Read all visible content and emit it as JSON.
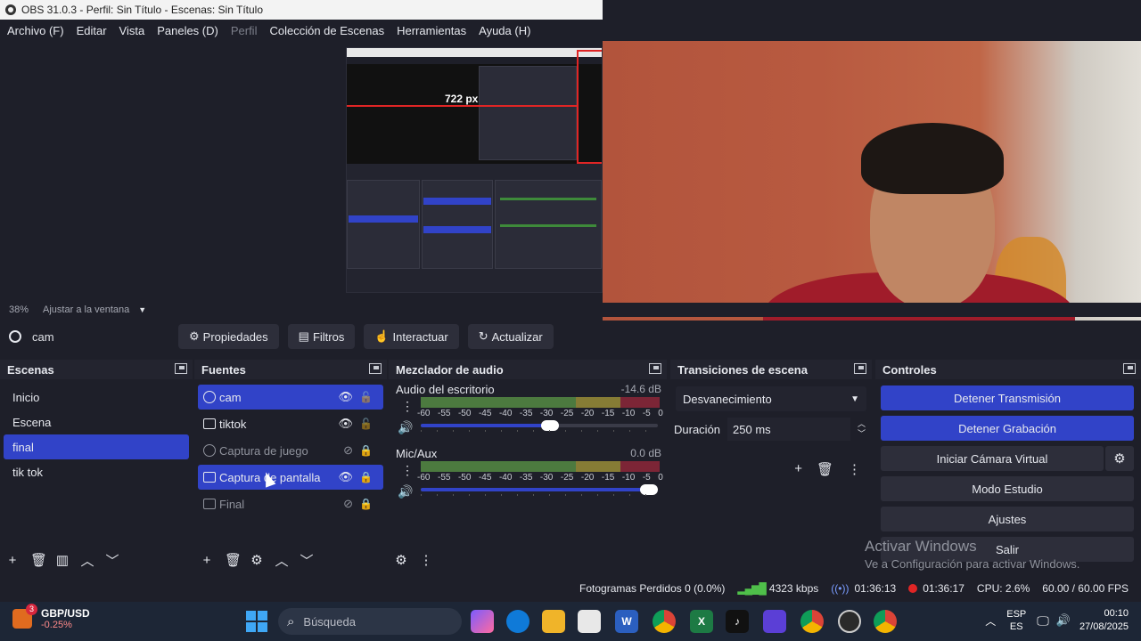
{
  "window": {
    "title": "OBS 31.0.3 - Perfil: Sin Título - Escenas: Sin Título"
  },
  "menu": [
    {
      "label": "Archivo (F)",
      "disabled": false
    },
    {
      "label": "Editar",
      "disabled": false
    },
    {
      "label": "Vista",
      "disabled": false
    },
    {
      "label": "Paneles (D)",
      "disabled": false
    },
    {
      "label": "Perfil",
      "disabled": true
    },
    {
      "label": "Colección de Escenas",
      "disabled": false
    },
    {
      "label": "Herramientas",
      "disabled": false
    },
    {
      "label": "Ayuda (H)",
      "disabled": false
    }
  ],
  "preview": {
    "inner_label": "722 px"
  },
  "zoom": {
    "level": "38%",
    "mode": "Ajustar a la ventana"
  },
  "source_toolbar": {
    "current_source": "cam",
    "buttons": {
      "properties": "Propiedades",
      "filters": "Filtros",
      "interact": "Interactuar",
      "refresh": "Actualizar"
    }
  },
  "scenes": {
    "title": "Escenas",
    "items": [
      "Inicio",
      "Escena",
      "final",
      "tik tok"
    ],
    "selected": "final"
  },
  "sources": {
    "title": "Fuentes",
    "items": [
      {
        "name": "cam",
        "icon": "camera-icon",
        "visible": true,
        "locked": false,
        "selected": true
      },
      {
        "name": "tiktok",
        "icon": "window-icon",
        "visible": true,
        "locked": false,
        "selected": false
      },
      {
        "name": "Captura de juego",
        "icon": "gamepad-icon",
        "visible": false,
        "locked": true,
        "selected": false
      },
      {
        "name": "Captura de pantalla",
        "icon": "monitor-icon",
        "visible": true,
        "locked": true,
        "selected": true
      },
      {
        "name": "Final",
        "icon": "image-icon",
        "visible": false,
        "locked": true,
        "selected": false
      }
    ]
  },
  "mixer": {
    "title": "Mezclador de audio",
    "ticks": [
      "-60",
      "-55",
      "-50",
      "-45",
      "-40",
      "-35",
      "-30",
      "-25",
      "-20",
      "-15",
      "-10",
      "-5",
      "0"
    ],
    "channels": [
      {
        "name": "Audio del escritorio",
        "db": "-14.6 dB",
        "volume": 0.55
      },
      {
        "name": "Mic/Aux",
        "db": "0.0 dB",
        "volume": 1.0
      }
    ]
  },
  "transitions": {
    "title": "Transiciones de escena",
    "selected": "Desvanecimiento",
    "duration_label": "Duración",
    "duration_value": "250 ms"
  },
  "controls": {
    "title": "Controles",
    "stop_stream": "Detener Transmisión",
    "stop_record": "Detener Grabación",
    "virtual_cam": "Iniciar Cámara Virtual",
    "studio_mode": "Modo Estudio",
    "settings": "Ajustes",
    "exit": "Salir"
  },
  "watermark": {
    "line1": "Activar Windows",
    "line2": "Ve a Configuración para activar Windows."
  },
  "status": {
    "dropped": "Fotogramas Perdidos 0 (0.0%)",
    "bitrate": "4323 kbps",
    "stream_time": "01:36:13",
    "record_time": "01:36:17",
    "cpu": "CPU: 2.6%",
    "fps": "60.00 / 60.00 FPS"
  },
  "taskbar": {
    "widget_title": "GBP/USD",
    "widget_value": "-0.25%",
    "widget_badge": "3",
    "search_placeholder": "Búsqueda",
    "lang_top": "ESP",
    "lang_bottom": "ES",
    "time": "00:10",
    "date": "27/08/2025"
  },
  "colors": {
    "accent": "#3143c8",
    "panel": "#23242f",
    "bg": "#1e1f29",
    "record": "#e02525"
  }
}
